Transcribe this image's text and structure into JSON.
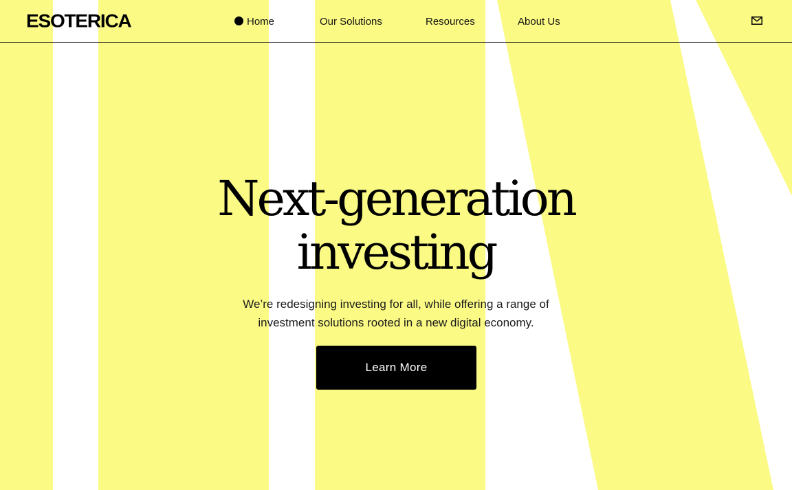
{
  "colors": {
    "background_yellow": "#FBFA85",
    "background_white": "#FFFFFF",
    "text": "#000000",
    "button_bg": "#000000",
    "button_text": "#FFFFFF"
  },
  "header": {
    "logo": "ESOTERICA",
    "nav": [
      {
        "label": "Home",
        "active": true
      },
      {
        "label": "Our Solutions",
        "active": false
      },
      {
        "label": "Resources",
        "active": false
      },
      {
        "label": "About Us",
        "active": false
      }
    ],
    "contact_icon": "mail-icon"
  },
  "hero": {
    "title_line1": "Next-generation",
    "title_line2": "investing",
    "subtitle_line1": "We’re redesigning investing for all, while offering a range of",
    "subtitle_line2": "investment solutions rooted in a new digital economy.",
    "cta_label": "Learn More"
  }
}
